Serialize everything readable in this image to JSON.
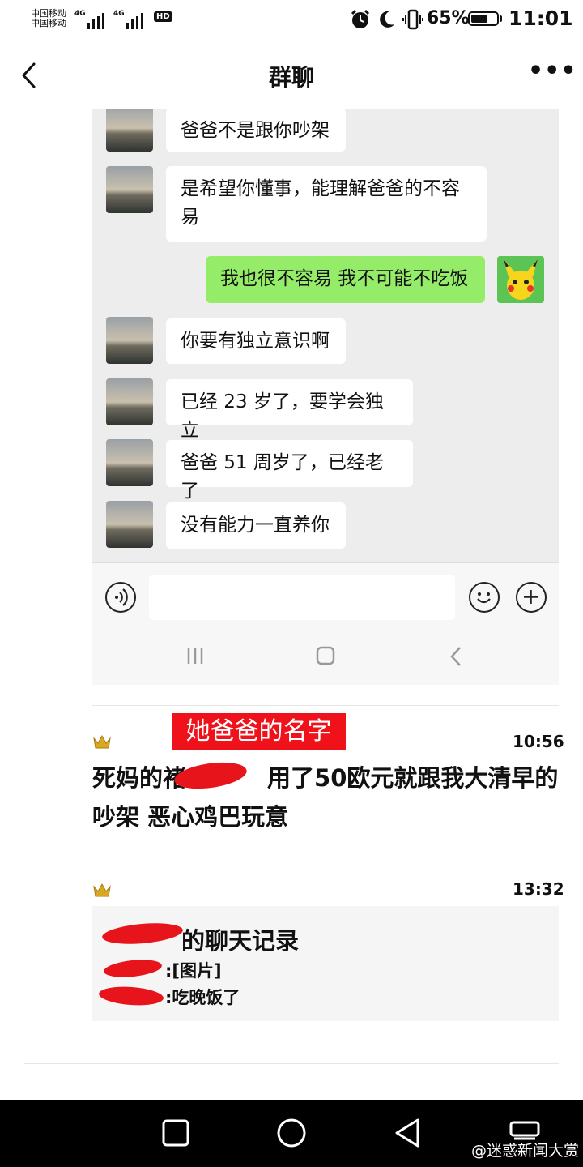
{
  "status_bar": {
    "carrier1": "中国移动",
    "carrier2": "中国移动",
    "net1": "4G",
    "net2": "4G",
    "hd": "HD",
    "battery": "65%",
    "battery_level": 0.65,
    "time": "11:01"
  },
  "header": {
    "title": "群聊",
    "more": "•••"
  },
  "chat": {
    "messages": [
      {
        "side": "left",
        "text": "爸爸不是跟你吵架"
      },
      {
        "side": "left",
        "text": "是希望你懂事，能理解爸爸的不容易"
      },
      {
        "side": "right",
        "text": "我也很不容易 我不可能不吃饭"
      },
      {
        "side": "left",
        "text": "你要有独立意识啊"
      },
      {
        "side": "left",
        "text": "已经 23 岁了，要学会独立"
      },
      {
        "side": "left",
        "text": "爸爸 51 周岁了，已经老了"
      },
      {
        "side": "left",
        "text": "没有能力一直养你"
      }
    ]
  },
  "annotation": "她爸爸的名字",
  "post1": {
    "time": "10:56",
    "text_a": "死妈的褚",
    "text_b": "用了50欧元就跟我大清早的",
    "text_c": "吵架 恶心鸡巴玩意"
  },
  "post2": {
    "time": "13:32",
    "card_title": "的聊天记录",
    "line1": ":[图片]",
    "line2": ":吃晚饭了"
  },
  "watermark": "@迷惑新闻大赏",
  "colors": {
    "own_bubble": "#95ec69",
    "redact": "#e8141c",
    "annotation_bg": "#f0121a"
  }
}
